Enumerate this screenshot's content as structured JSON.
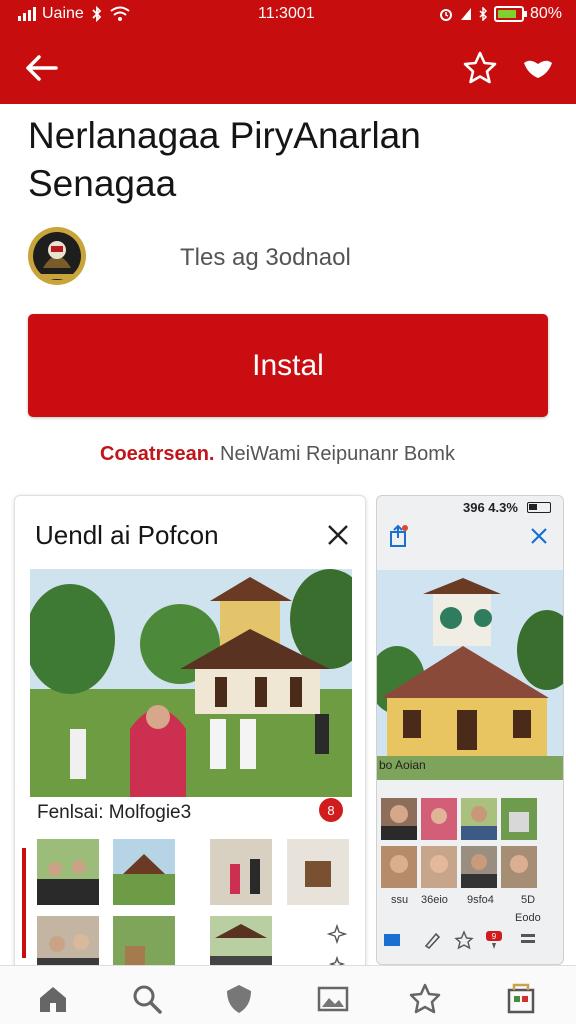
{
  "status": {
    "carrier": "Uaine",
    "time": "11:3001",
    "battery": "80%",
    "battery_level": 0.8,
    "battery_color": "#7fd130"
  },
  "appbar": {
    "back_icon": "arrow-left-icon",
    "favorite_icon": "star-icon",
    "heart_icon": "heart-icon",
    "bar_color": "#c70d0d"
  },
  "app": {
    "title": "Nerlanagaa PiryAnarlan Senagaa",
    "developer": "Tles ag 3odnaol",
    "install_label": "Instal",
    "notice_red": "Coeatrsean.",
    "notice_rest": " NeiWami Reipunanr Bomk"
  },
  "card_left": {
    "title": "Uendl ai Pofcon",
    "caption": "Fenlsai: Molfogie3",
    "badge": "8"
  },
  "card_right": {
    "status": "396 4.3%",
    "caption": "bo Aoian",
    "labels_row1": [
      "ssu",
      "36eio",
      "9sfo4",
      "5D"
    ],
    "labels_row2": [
      "",
      "",
      "",
      "Eodo"
    ],
    "tab_badge": "9"
  },
  "bottom_nav": [
    "home-icon",
    "search-icon",
    "shield-icon",
    "image-icon",
    "star-icon",
    "apps-icon"
  ],
  "colors": {
    "accent": "#c70d0d",
    "install": "#c90d11"
  }
}
